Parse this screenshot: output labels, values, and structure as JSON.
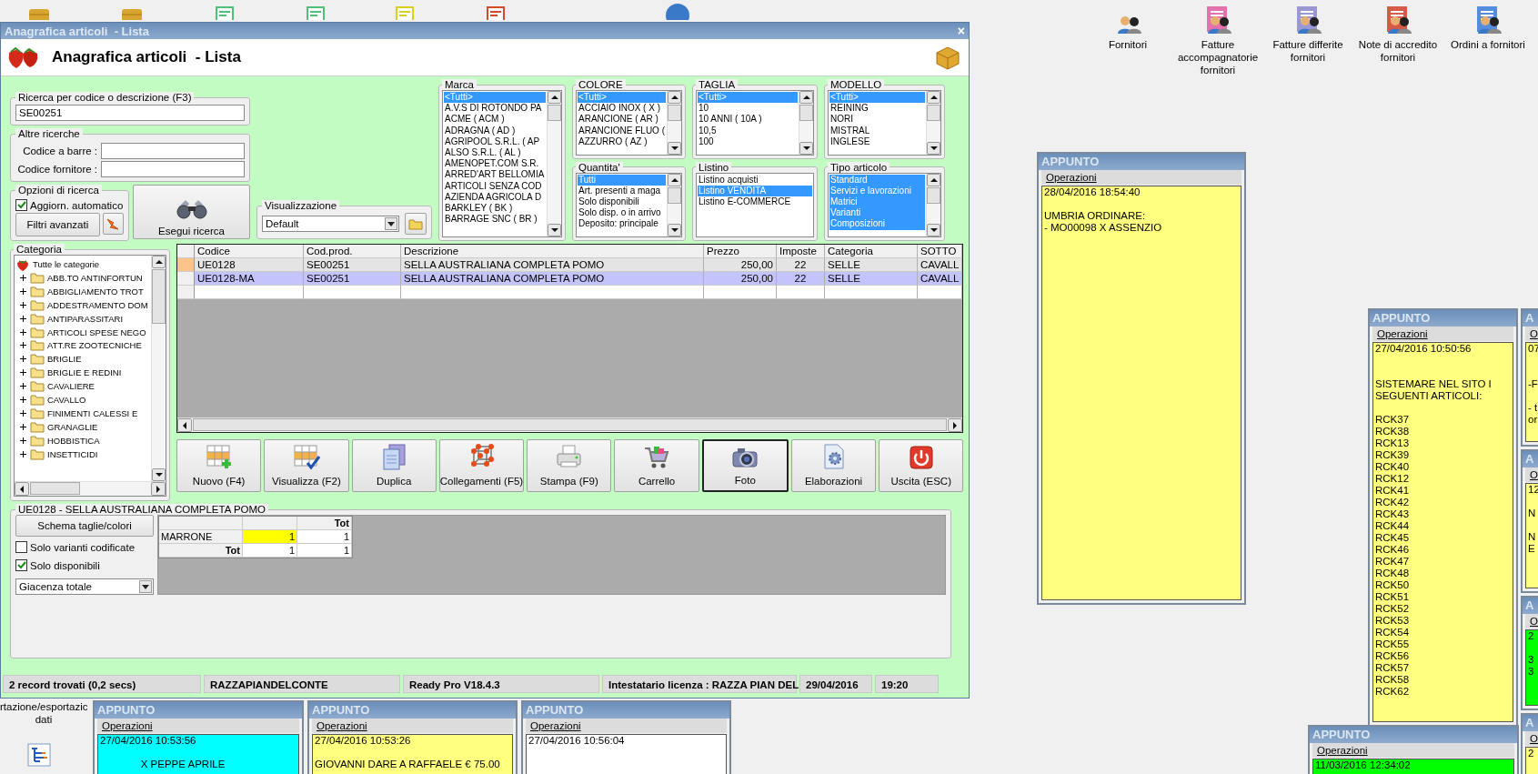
{
  "desktop": {
    "shortcuts": [
      {
        "label": "Fornitori"
      },
      {
        "label": "Fatture accompagnatorie fornitori"
      },
      {
        "label": "Fatture differite fornitori"
      },
      {
        "label": "Note di accredito fornitori"
      },
      {
        "label": "Ordini a fornitori"
      }
    ],
    "cut_label": "rtazione/esportazic\ndati"
  },
  "window": {
    "title": "Anagrafica articoli  - Lista",
    "close": "×",
    "heading": "Anagrafica articoli  - Lista"
  },
  "search": {
    "legend": "Ricerca per codice o descrizione (F3)",
    "value": "SE00251"
  },
  "other_search": {
    "legend": "Altre ricerche",
    "fields": [
      {
        "label": "Codice a barre :"
      },
      {
        "label": "Codice fornitore :"
      }
    ]
  },
  "options": {
    "legend": "Opzioni di ricerca",
    "auto_update": {
      "label": "Aggiorn. automatico",
      "checked": true
    },
    "advanced_button": "Filtri avanzati"
  },
  "search_button": "Esegui ricerca",
  "view": {
    "legend": "Visualizzazione",
    "value": "Default"
  },
  "filters": [
    {
      "legend": "Marca",
      "scrollbar": true,
      "items": [
        {
          "label": "<Tutti>",
          "selected": true
        },
        {
          "label": "A.V.S DI ROTONDO PA",
          "selected": false
        },
        {
          "label": "ACME ( ACM )",
          "selected": false
        },
        {
          "label": "ADRAGNA ( AD )",
          "selected": false
        },
        {
          "label": "AGRIPOOL S.R.L. ( AP",
          "selected": false
        },
        {
          "label": "ALSO S.R.L. ( AL )",
          "selected": false
        },
        {
          "label": "AMENOPET.COM S.R.",
          "selected": false
        },
        {
          "label": "ARRED'ART BELLOMIA",
          "selected": false
        },
        {
          "label": "ARTICOLI SENZA COD",
          "selected": false
        },
        {
          "label": "AZIENDA AGRICOLA D",
          "selected": false
        },
        {
          "label": "BARKLEY  ( BK )",
          "selected": false
        },
        {
          "label": "BARRAGE SNC ( BR )",
          "selected": false
        }
      ]
    },
    {
      "legend": "COLORE",
      "scrollbar": true,
      "items": [
        {
          "label": "<Tutti>",
          "selected": true
        },
        {
          "label": "ACCIAIO INOX ( X )",
          "selected": false
        },
        {
          "label": "ARANCIONE ( AR )",
          "selected": false
        },
        {
          "label": "ARANCIONE FLUO (",
          "selected": false
        },
        {
          "label": "AZZURRO ( AZ )",
          "selected": false
        }
      ]
    },
    {
      "legend": "TAGLIA",
      "scrollbar": true,
      "items": [
        {
          "label": "<Tutti>",
          "selected": true
        },
        {
          "label": "10",
          "selected": false
        },
        {
          "label": "10 ANNI ( 10A )",
          "selected": false
        },
        {
          "label": "10,5",
          "selected": false
        },
        {
          "label": "100",
          "selected": false
        }
      ]
    },
    {
      "legend": "MODELLO",
      "scrollbar": true,
      "items": [
        {
          "label": "<Tutti>",
          "selected": true
        },
        {
          "label": "REINING",
          "selected": false
        },
        {
          "label": "NORI",
          "selected": false
        },
        {
          "label": "MISTRAL",
          "selected": false
        },
        {
          "label": "INGLESE",
          "selected": false
        }
      ]
    },
    {
      "legend": "Quantita'",
      "scrollbar": true,
      "items": [
        {
          "label": "Tutti",
          "selected": true
        },
        {
          "label": "Art. presenti a maga",
          "selected": false
        },
        {
          "label": "Solo disponibili",
          "selected": false
        },
        {
          "label": "Solo disp. o in arrivo",
          "selected": false
        },
        {
          "label": "Deposito: principale",
          "selected": false
        }
      ]
    },
    {
      "legend": "Listino",
      "scrollbar": false,
      "items": [
        {
          "label": "Listino acquisti",
          "selected": false
        },
        {
          "label": "Listino VENDITA",
          "selected": true
        },
        {
          "label": "Listino E-COMMERCE",
          "selected": false
        }
      ]
    },
    {
      "legend": "Tipo articolo",
      "scrollbar": true,
      "items": [
        {
          "label": "Standard",
          "selected": true
        },
        {
          "label": "Servizi e lavorazioni",
          "selected": true
        },
        {
          "label": "Matrici",
          "selected": true
        },
        {
          "label": "Varianti",
          "selected": true
        },
        {
          "label": "Composizioni",
          "selected": true
        }
      ]
    }
  ],
  "category": {
    "legend": "Categoria",
    "root": "Tutte le categorie",
    "items": [
      {
        "label": "ABB.TO ANTINFORTUN",
        "expanded": false
      },
      {
        "label": "ABBIGLIAMENTO TROT",
        "expanded": false
      },
      {
        "label": "ADDESTRAMENTO DOM",
        "expanded": false
      },
      {
        "label": "ANTIPARASSITARI",
        "expanded": false
      },
      {
        "label": "ARTICOLI SPESE NEGO",
        "expanded": false
      },
      {
        "label": "ATT.RE ZOOTECNICHE",
        "expanded": false
      },
      {
        "label": "BRIGLIE",
        "expanded": false
      },
      {
        "label": "BRIGLIE E REDINI",
        "expanded": false
      },
      {
        "label": "CAVALIERE",
        "expanded": false
      },
      {
        "label": "CAVALLO",
        "expanded": false
      },
      {
        "label": "FINIMENTI CALESSI E",
        "expanded": false
      },
      {
        "label": "GRANAGLIE",
        "expanded": false
      },
      {
        "label": "HOBBISTICA",
        "expanded": false
      },
      {
        "label": "INSETTICIDI",
        "expanded": false
      }
    ]
  },
  "grid": {
    "columns": [
      "Codice",
      "Cod.prod.",
      "Descrizione",
      "Prezzo",
      "Imposte",
      "Categoria",
      "SOTTO"
    ],
    "rows": [
      {
        "current": true,
        "selected": false,
        "cells": [
          "UE0128",
          "SE00251",
          "SELLA AUSTRALIANA COMPLETA POMO",
          "250,00",
          "22",
          "SELLE",
          "CAVALL"
        ]
      },
      {
        "current": false,
        "selected": true,
        "cells": [
          "UE0128-MA",
          "SE00251",
          "SELLA AUSTRALIANA COMPLETA POMO",
          "250,00",
          "22",
          "SELLE",
          "CAVALL"
        ]
      }
    ]
  },
  "buttons": [
    {
      "label": "Nuovo (F4)",
      "focused": false
    },
    {
      "label": "Visualizza (F2)",
      "focused": false
    },
    {
      "label": "Duplica",
      "focused": false
    },
    {
      "label": "Collegamenti (F5)",
      "focused": false
    },
    {
      "label": "Stampa (F9)",
      "focused": false
    },
    {
      "label": "Carrello",
      "focused": false
    },
    {
      "label": "Foto",
      "focused": true
    },
    {
      "label": "Elaborazioni",
      "focused": false
    },
    {
      "label": "Uscita (ESC)",
      "focused": false
    }
  ],
  "variants": {
    "legend": "UE0128 - SELLA AUSTRALIANA COMPLETA POMO",
    "schema_button": "Schema taglie/colori",
    "checks": [
      {
        "label": "Solo varianti codificate",
        "checked": false
      },
      {
        "label": "Solo disponibili",
        "checked": true
      }
    ],
    "select": "Giacenza totale",
    "table": {
      "header": "Tot",
      "rows": [
        {
          "label": "MARRONE",
          "total": false,
          "cells": [
            {
              "value": "1",
              "highlight": true
            },
            {
              "value": "1",
              "highlight": false
            }
          ]
        },
        {
          "label": "Tot",
          "total": true,
          "cells": [
            {
              "value": "1",
              "highlight": false
            },
            {
              "value": "1",
              "highlight": false
            }
          ]
        }
      ]
    }
  },
  "status_bar": [
    "2 record trovati (0,2 secs)",
    "RAZZAPIANDELCONTE",
    "Ready Pro V18.4.3",
    "Intestatario licenza : RAZZA PIAN DEL",
    "29/04/2016",
    "19:20"
  ],
  "notes": [
    {
      "title": "APPUNTO",
      "menu": "Operazioni",
      "color": "#ffff80",
      "text": "28/04/2016 18:54:40\n\nUMBRIA ORDINARE:\n- MO00098 X ASSENZIO"
    },
    {
      "title": "APPUNTO",
      "menu": "Operazioni",
      "color": "#ffff80",
      "text": "27/04/2016 10:50:56\n\n\nSISTEMARE NEL SITO I\nSEGUENTI ARTICOLI:\n\nRCK37\nRCK38\nRCK13\nRCK39\nRCK40\nRCK12\nRCK41\nRCK42\nRCK43\nRCK44\nRCK45\nRCK46\nRCK47\nRCK48\nRCK50\nRCK51\nRCK52\nRCK53\nRCK54\nRCK55\nRCK56\nRCK57\nRCK58\nRCK62"
    },
    {
      "title": "A",
      "menu": "O",
      "color": "#ffff80",
      "text": "07\n\n\n-F\n\n- t\nor"
    },
    {
      "title": "A",
      "menu": "O",
      "color": "#ffff80",
      "text": "12\n\nN\n\nN\nE"
    },
    {
      "title": "A",
      "menu": "O",
      "color": "#00ff00",
      "text": "2\n\n3\n3"
    },
    {
      "title": "APPUNTO",
      "menu": "Operazioni",
      "color": "#00ffff",
      "text": "27/04/2016 10:53:56\n\n              X PEPPE APRILE"
    },
    {
      "title": "APPUNTO",
      "menu": "Operazioni",
      "color": "#ffff80",
      "text": "27/04/2016 10:53:26\n\nGIOVANNI DARE A RAFFAELE € 75.00"
    },
    {
      "title": "APPUNTO",
      "menu": "Operazioni",
      "color": "#ffffff",
      "text": "27/04/2016 10:56:04"
    },
    {
      "title": "APPUNTO",
      "menu": "Operazioni",
      "color": "#00ff00",
      "text": "11/03/2016 12:34:02"
    },
    {
      "title": "A",
      "menu": "O",
      "color": "#ffff80",
      "text": "2"
    }
  ]
}
